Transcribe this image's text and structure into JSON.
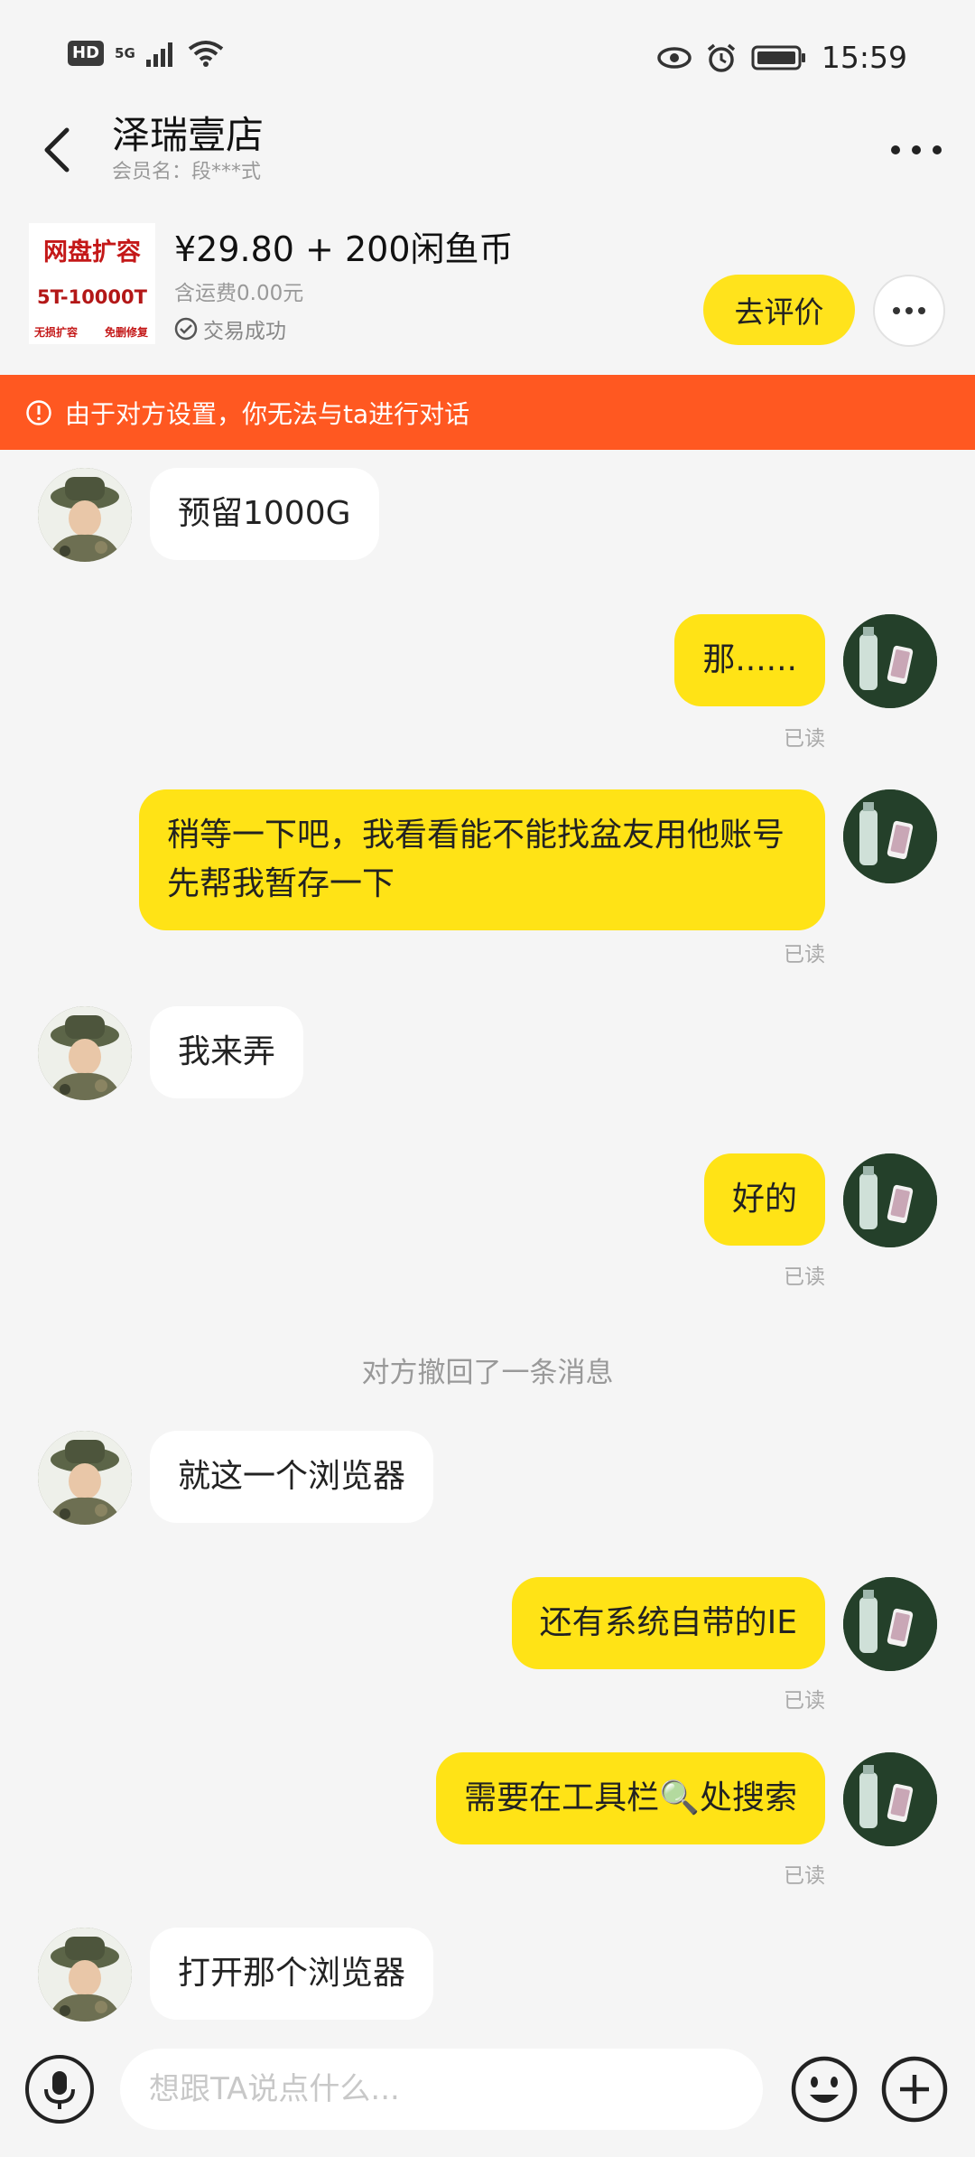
{
  "status_bar": {
    "time": "15:59",
    "hd": "HD",
    "network": "5G"
  },
  "header": {
    "title": "泽瑞壹店",
    "member": "会员名：段***式"
  },
  "order": {
    "thumb_title": "网盘扩容",
    "thumb_sub": "5T-10000T",
    "thumb_tag1": "无损扩容",
    "thumb_tag2": "免删修复",
    "price": "¥29.80 + 200闲鱼币",
    "shipping": "含运费0.00元",
    "status": "交易成功",
    "review_button": "去评价"
  },
  "notice": "由于对方设置，你无法与ta进行对话",
  "messages": [
    {
      "side": "in",
      "text": "预留1000G"
    },
    {
      "side": "out",
      "text": "那......",
      "read": "已读"
    },
    {
      "side": "out",
      "text": "稍等一下吧，我看看能不能找盆友用他账号先帮我暂存一下",
      "read": "已读"
    },
    {
      "side": "in",
      "text": "我来弄"
    },
    {
      "side": "out",
      "text": "好的",
      "read": "已读"
    },
    {
      "side": "system",
      "text": "对方撤回了一条消息"
    },
    {
      "side": "in",
      "text": "就这一个浏览器"
    },
    {
      "side": "out",
      "text": "还有系统自带的IE",
      "read": "已读"
    },
    {
      "side": "out",
      "text": "需要在工具栏🔍处搜索",
      "read": "已读"
    },
    {
      "side": "in",
      "text": "打开那个浏览器"
    }
  ],
  "input": {
    "placeholder": "想跟TA说点什么..."
  }
}
